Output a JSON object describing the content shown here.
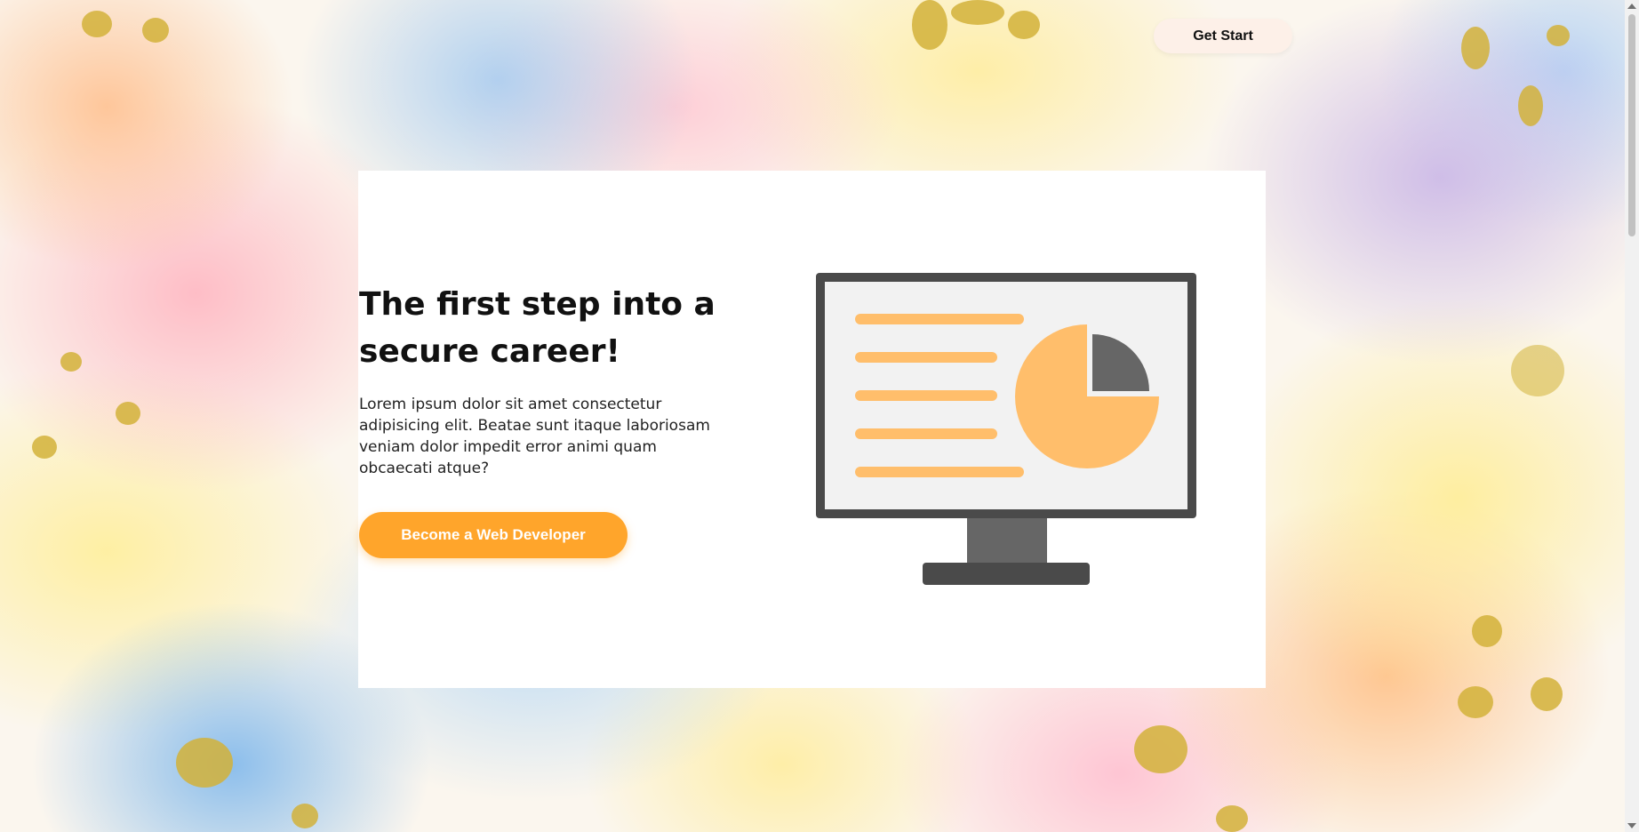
{
  "header": {
    "cta_label": "Get Start"
  },
  "hero": {
    "headline": "The first step into a secure career!",
    "description": "Lorem ipsum dolor sit amet consectetur adipisicing elit. Beatae sunt itaque laboriosam veniam dolor impedit error animi quam obcaecati atque?",
    "cta_label": "Become a Web Developer"
  },
  "illustration": {
    "icon": "monitor-with-pie-chart-icon",
    "pie_highlight_fraction": 0.25
  },
  "colors": {
    "accent": "#ffa52b",
    "accent_light": "#ffbe6b",
    "monitor_dark": "#4a4a4a",
    "monitor_mid": "#666666",
    "screen_bg": "#f2f2f2",
    "card_bg": "#ffffff"
  }
}
